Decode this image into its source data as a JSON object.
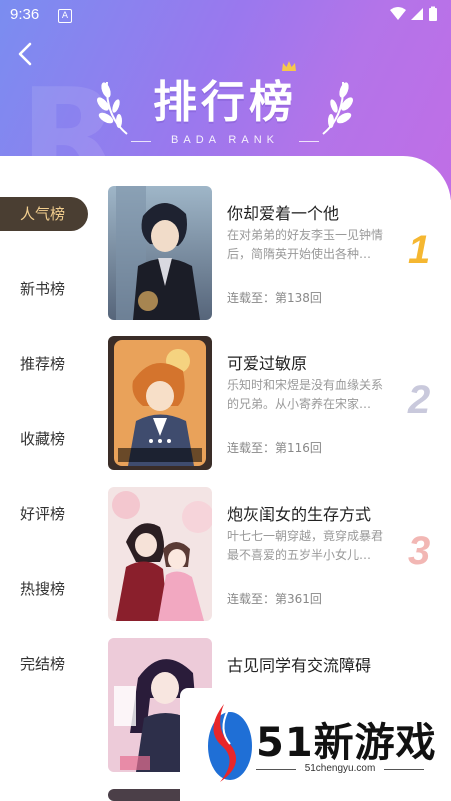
{
  "status": {
    "time": "9:36",
    "indicator": "A"
  },
  "header": {
    "title": "排行榜",
    "subtitle": "BADA RANK",
    "bg_letter": "R"
  },
  "sidebar": {
    "items": [
      {
        "label": "人气榜",
        "active": true
      },
      {
        "label": "新书榜",
        "active": false
      },
      {
        "label": "推荐榜",
        "active": false
      },
      {
        "label": "收藏榜",
        "active": false
      },
      {
        "label": "好评榜",
        "active": false
      },
      {
        "label": "热搜榜",
        "active": false
      },
      {
        "label": "完结榜",
        "active": false
      }
    ]
  },
  "books": [
    {
      "title": "你却爱着一个他",
      "desc": "在对弟弟的好友李玉一见钟情后，简隋英开始使出各种…",
      "chapter": "连载至：第138回",
      "rank": "1",
      "rank_color": "#f5b731"
    },
    {
      "title": "可爱过敏原",
      "desc": "乐知时和宋煜是没有血缘关系的兄弟。从小寄养在宋家…",
      "chapter": "连载至：第116回",
      "rank": "2",
      "rank_color": "#c9c9dc"
    },
    {
      "title": "炮灰闺女的生存方式",
      "desc": "叶七七一朝穿越，竟穿成暴君最不喜爱的五岁半小女儿…",
      "chapter": "连载至：第361回",
      "rank": "3",
      "rank_color": "#f2b7b4"
    },
    {
      "title": "古见同学有交流障碍",
      "desc": "",
      "chapter": "",
      "rank": "",
      "rank_color": "#cccccc"
    }
  ],
  "watermark": {
    "brand": "51新游戏",
    "url": "51chengyu.com"
  },
  "colors": {
    "header_start": "#7a8df0",
    "header_end": "#c06ee6",
    "active_bg": "#4a3e32",
    "active_text": "#f3cf8f"
  }
}
